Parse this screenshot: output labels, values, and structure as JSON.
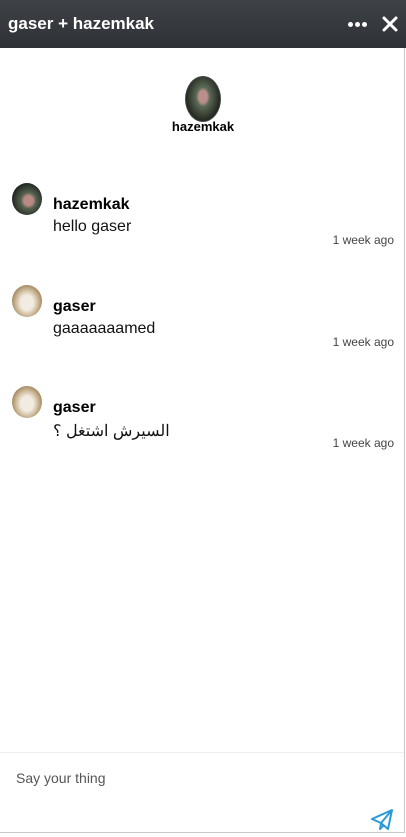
{
  "header": {
    "title": "gaser + hazemkak",
    "more_icon": "more-horizontal-icon",
    "close_icon": "close-icon",
    "background": "#353a3f"
  },
  "participant": {
    "name": "hazemkak",
    "avatar_icon": "avatar"
  },
  "messages": [
    {
      "author": "hazemkak",
      "text": "hello gaser",
      "time": "1 week ago"
    },
    {
      "author": "gaser",
      "text": "gaaaaaaamed",
      "time": "1 week ago"
    },
    {
      "author": "gaser",
      "text": "السيرش اشتغل ؟",
      "time": "1 week ago"
    }
  ],
  "composer": {
    "placeholder": "Say your thing",
    "send_icon": "send-icon",
    "send_color": "#2b9ad6"
  }
}
